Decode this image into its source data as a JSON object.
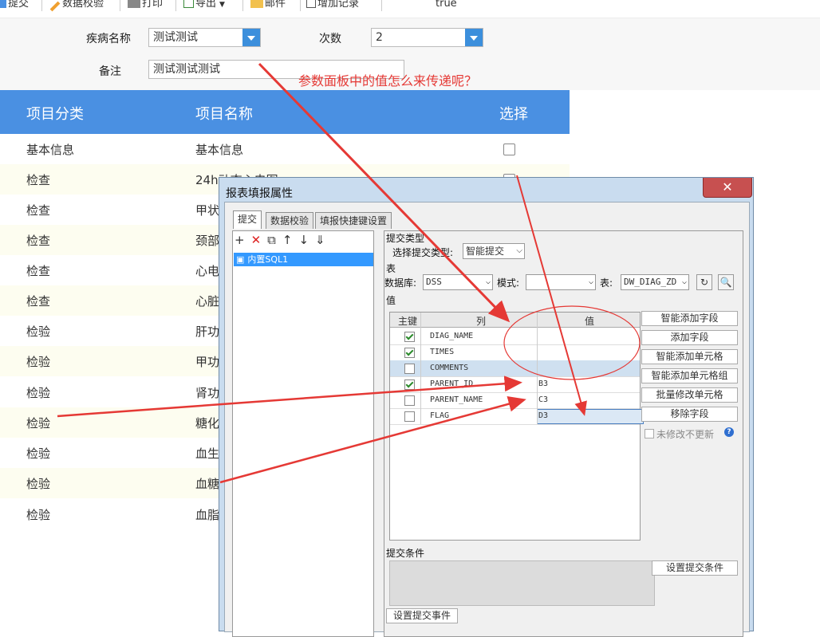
{
  "toolbar": {
    "items": [
      "提交",
      "数据校验",
      "打印",
      "导出",
      "邮件",
      "增加记录"
    ],
    "status_text": "true"
  },
  "params": {
    "disease_label": "疾病名称",
    "disease_value": "测试测试",
    "times_label": "次数",
    "times_value": "2",
    "remark_label": "备注",
    "remark_value": "测试测试测试"
  },
  "annotation": "参数面板中的值怎么来传递呢？",
  "table": {
    "headers": [
      "项目分类",
      "项目名称",
      "选择"
    ],
    "rows": [
      [
        "基本信息",
        "基本信息"
      ],
      [
        "检查",
        "24h动态心电图"
      ],
      [
        "检查",
        "甲状"
      ],
      [
        "检查",
        "颈部"
      ],
      [
        "检查",
        "心电"
      ],
      [
        "检查",
        "心脏"
      ],
      [
        "检验",
        "肝功"
      ],
      [
        "检验",
        "甲功"
      ],
      [
        "检验",
        "肾功"
      ],
      [
        "检验",
        "糖化"
      ],
      [
        "检验",
        "血生"
      ],
      [
        "检验",
        "血糖"
      ],
      [
        "检验",
        "血脂"
      ]
    ]
  },
  "dialog": {
    "title": "报表填报属性",
    "close_label": "✕",
    "tabs": [
      "提交",
      "数据校验",
      "填报快捷键设置"
    ],
    "left_item": "内置SQL1",
    "submit_type_section": "提交类型",
    "submit_type_label": "选择提交类型:",
    "submit_type_value": "智能提交",
    "table_section": "表",
    "db_label": "数据库:",
    "db_value": "DSS",
    "schema_label": "模式:",
    "schema_value": "",
    "table_label": "表:",
    "table_value": "DW_DIAG_ZD",
    "value_section": "值",
    "grid_headers": [
      "主键",
      "列",
      "值"
    ],
    "grid_rows": [
      {
        "checked": true,
        "column": "DIAG_NAME",
        "value": ""
      },
      {
        "checked": true,
        "column": "TIMES",
        "value": ""
      },
      {
        "checked": false,
        "column": "COMMENTS",
        "value": ""
      },
      {
        "checked": true,
        "column": "PARENT_ID",
        "value": "B3"
      },
      {
        "checked": false,
        "column": "PARENT_NAME",
        "value": "C3"
      },
      {
        "checked": false,
        "column": "FLAG",
        "value": "D3"
      }
    ],
    "side_buttons": [
      "智能添加字段",
      "添加字段",
      "智能添加单元格",
      "智能添加单元格组",
      "批量修改单元格",
      "移除字段"
    ],
    "unmodified_label": "未修改不更新",
    "condition_section": "提交条件",
    "set_condition_button": "设置提交条件",
    "set_event_button": "设置提交事件"
  },
  "colors": {
    "header_blue": "#4a90e2",
    "dropdown_blue": "#3c8fdc",
    "annotation_red": "#e53935",
    "selected_item": "#3399ff"
  }
}
